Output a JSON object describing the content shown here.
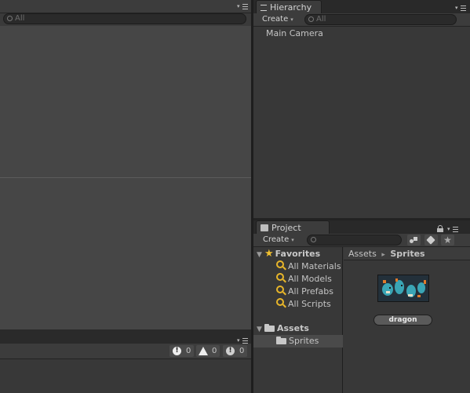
{
  "scene": {
    "search_placeholder": "All"
  },
  "hierarchy": {
    "tab_label": "Hierarchy",
    "create_label": "Create",
    "search_placeholder": "All",
    "items": [
      "Main Camera"
    ]
  },
  "project": {
    "tab_label": "Project",
    "create_label": "Create",
    "search_placeholder": "",
    "favorites": {
      "label": "Favorites",
      "items": [
        "All Materials",
        "All Models",
        "All Prefabs",
        "All Scripts"
      ]
    },
    "assets": {
      "label": "Assets",
      "children": [
        "Sprites"
      ],
      "selected": "Sprites"
    },
    "breadcrumb": {
      "root": "Assets",
      "separator": "▸",
      "current": "Sprites"
    },
    "asset_grid": [
      {
        "name": "dragon"
      }
    ]
  },
  "console": {
    "info_count": "0",
    "warning_count": "0",
    "error_count": "0"
  },
  "icons": {
    "favorites_star": "star-icon",
    "folder": "folder-icon",
    "search_saved": "search-icon",
    "label_filter": "tag-icon",
    "type_filter": "shapes-icon"
  },
  "colors": {
    "panel_bg": "#383838",
    "toolbar_bg": "#3c3c3c",
    "favorites_gold": "#e8b62a",
    "selection": "#4a4a4a"
  }
}
